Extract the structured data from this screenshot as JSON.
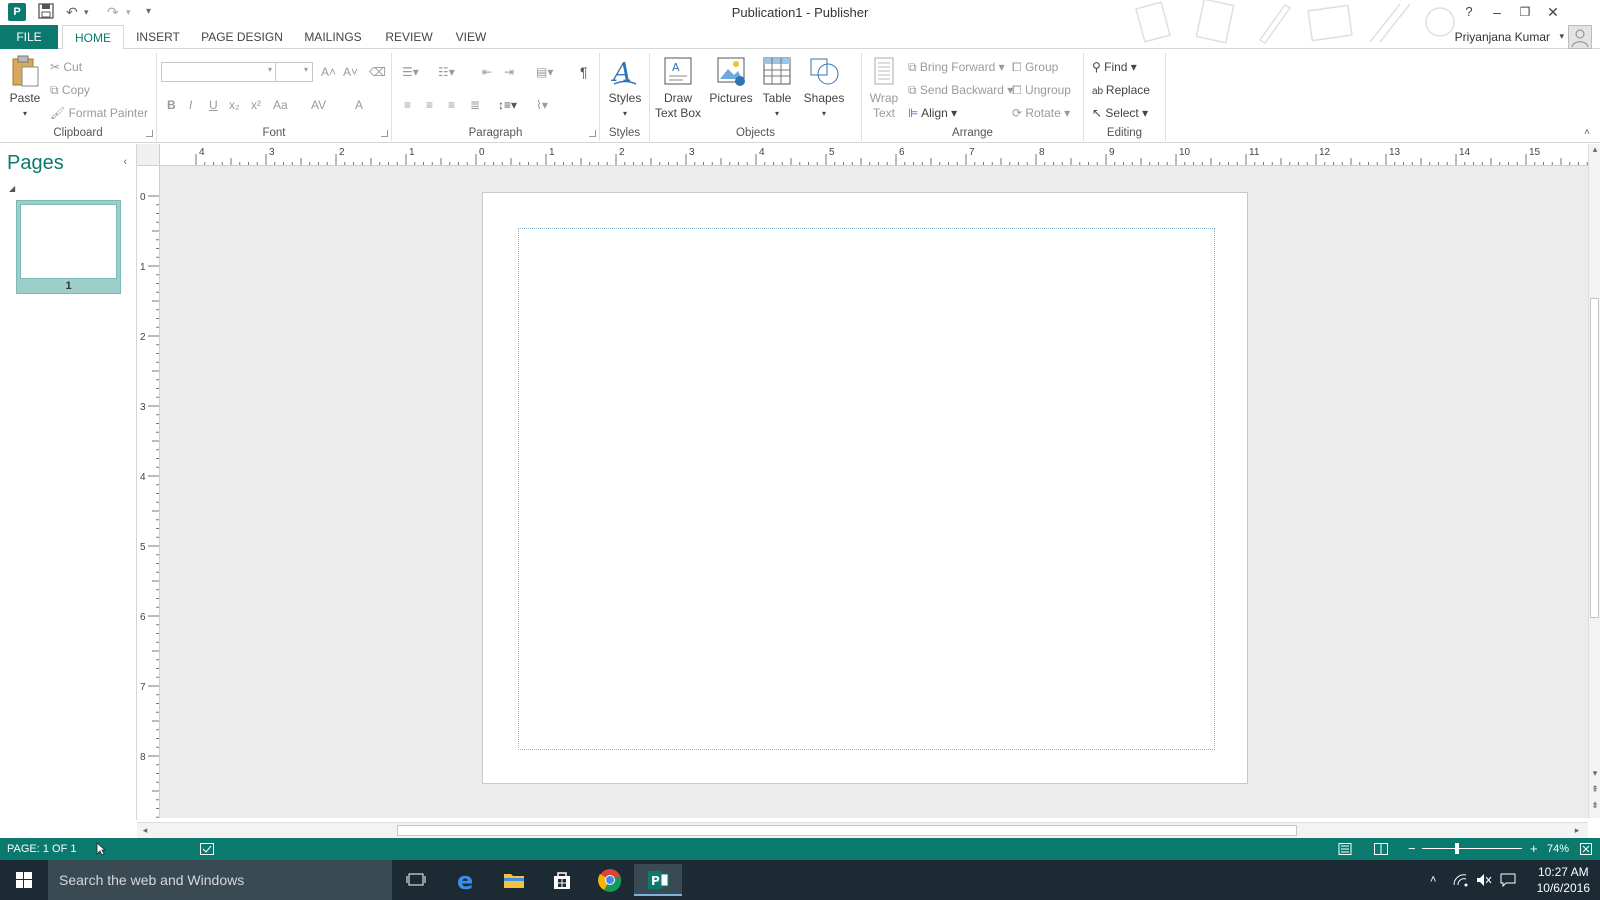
{
  "app": {
    "title": "Publication1 - Publisher",
    "icon_letter": "P",
    "accent": "#0b7a6e"
  },
  "window_controls": {
    "help": "?",
    "minimize": "–",
    "restore": "❐",
    "close": "✕"
  },
  "qat": {
    "save": "💾",
    "undo": "↶",
    "redo": "↷",
    "customize": "▾"
  },
  "tabs": [
    {
      "label": "FILE"
    },
    {
      "label": "HOME"
    },
    {
      "label": "INSERT"
    },
    {
      "label": "PAGE DESIGN"
    },
    {
      "label": "MAILINGS"
    },
    {
      "label": "REVIEW"
    },
    {
      "label": "VIEW"
    }
  ],
  "user": {
    "name": "Priyanjana Kumar"
  },
  "ribbon": {
    "clipboard": {
      "label": "Clipboard",
      "paste": "Paste",
      "cut": "Cut",
      "copy": "Copy",
      "format_painter": "Format Painter"
    },
    "font": {
      "label": "Font",
      "bold": "B",
      "italic": "I",
      "underline": "U",
      "subscript": "x₂",
      "superscript": "x²",
      "case": "Aa",
      "spacing": "AV",
      "color": "A",
      "grow": "A˄",
      "shrink": "A˅"
    },
    "paragraph": {
      "label": "Paragraph",
      "pilcrow": "¶"
    },
    "styles": {
      "label": "Styles",
      "button": "Styles"
    },
    "objects": {
      "label": "Objects",
      "draw_text_box_1": "Draw",
      "draw_text_box_2": "Text Box",
      "pictures": "Pictures",
      "table": "Table",
      "shapes": "Shapes"
    },
    "arrange": {
      "label": "Arrange",
      "wrap_text_1": "Wrap",
      "wrap_text_2": "Text",
      "bring_forward": "Bring Forward",
      "send_backward": "Send Backward",
      "align": "Align",
      "group": "Group",
      "ungroup": "Ungroup",
      "rotate": "Rotate"
    },
    "editing": {
      "label": "Editing",
      "find": "Find",
      "replace": "Replace",
      "select": "Select"
    }
  },
  "pages_pane": {
    "title": "Pages",
    "page_number": "1"
  },
  "ruler": {
    "h_labels": [
      "4",
      "3",
      "2",
      "1",
      "0",
      "1",
      "2",
      "3",
      "4",
      "5",
      "6",
      "7",
      "8",
      "9",
      "10",
      "11",
      "12",
      "13",
      "14",
      "15"
    ],
    "v_labels": [
      "0",
      "1",
      "2",
      "3",
      "4",
      "5",
      "6",
      "7",
      "8"
    ]
  },
  "status": {
    "page": "PAGE: 1 OF 1",
    "zoom": "74%"
  },
  "taskbar": {
    "search_placeholder": "Search the web and Windows",
    "time": "10:27 AM",
    "date": "10/6/2016"
  }
}
